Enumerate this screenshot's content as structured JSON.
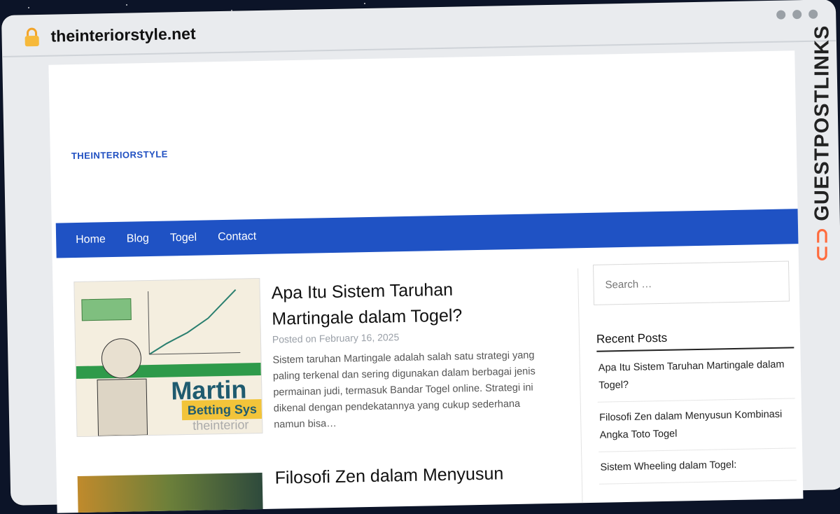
{
  "browser": {
    "domain": "theinteriorstyle.net"
  },
  "site": {
    "title": "THEINTERIORSTYLE",
    "nav": [
      "Home",
      "Blog",
      "Togel",
      "Contact"
    ]
  },
  "posts": [
    {
      "title": "Apa Itu Sistem Taruhan Martingale dalam Togel?",
      "meta": "Posted on February 16, 2025",
      "excerpt": "Sistem taruhan Martingale adalah salah satu strategi yang paling terkenal dan sering digunakan dalam berbagai jenis permainan judi, termasuk Bandar Togel online. Strategi ini dikenal dengan pendekatannya yang cukup sederhana namun bisa…",
      "thumb_text": {
        "big": "Martin",
        "sub": "Betting Sys",
        "wm": "theinterior"
      }
    },
    {
      "title": "Filosofi Zen dalam Menyusun"
    }
  ],
  "sidebar": {
    "search_placeholder": "Search …",
    "recent_title": "Recent Posts",
    "recent": [
      "Apa Itu Sistem Taruhan Martingale dalam Togel?",
      "Filosofi Zen dalam Menyusun Kombinasi Angka Toto Togel",
      "Sistem Wheeling dalam Togel:"
    ]
  },
  "watermark": {
    "text": "GUESTPOSTLINKS",
    "icon": "chain-link-icon",
    "accent": "#ff6b3d"
  }
}
